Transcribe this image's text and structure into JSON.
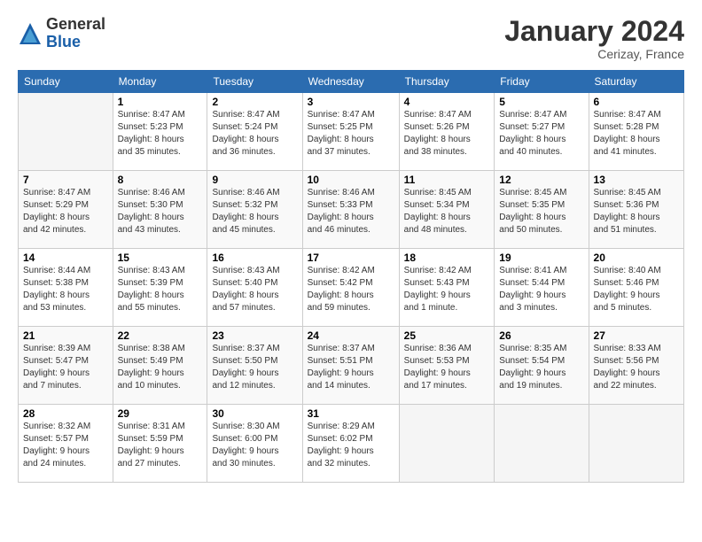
{
  "logo": {
    "general": "General",
    "blue": "Blue"
  },
  "title": "January 2024",
  "location": "Cerizay, France",
  "days_header": [
    "Sunday",
    "Monday",
    "Tuesday",
    "Wednesday",
    "Thursday",
    "Friday",
    "Saturday"
  ],
  "weeks": [
    [
      {
        "day": "",
        "info": ""
      },
      {
        "day": "1",
        "info": "Sunrise: 8:47 AM\nSunset: 5:23 PM\nDaylight: 8 hours\nand 35 minutes."
      },
      {
        "day": "2",
        "info": "Sunrise: 8:47 AM\nSunset: 5:24 PM\nDaylight: 8 hours\nand 36 minutes."
      },
      {
        "day": "3",
        "info": "Sunrise: 8:47 AM\nSunset: 5:25 PM\nDaylight: 8 hours\nand 37 minutes."
      },
      {
        "day": "4",
        "info": "Sunrise: 8:47 AM\nSunset: 5:26 PM\nDaylight: 8 hours\nand 38 minutes."
      },
      {
        "day": "5",
        "info": "Sunrise: 8:47 AM\nSunset: 5:27 PM\nDaylight: 8 hours\nand 40 minutes."
      },
      {
        "day": "6",
        "info": "Sunrise: 8:47 AM\nSunset: 5:28 PM\nDaylight: 8 hours\nand 41 minutes."
      }
    ],
    [
      {
        "day": "7",
        "info": "Sunrise: 8:47 AM\nSunset: 5:29 PM\nDaylight: 8 hours\nand 42 minutes."
      },
      {
        "day": "8",
        "info": "Sunrise: 8:46 AM\nSunset: 5:30 PM\nDaylight: 8 hours\nand 43 minutes."
      },
      {
        "day": "9",
        "info": "Sunrise: 8:46 AM\nSunset: 5:32 PM\nDaylight: 8 hours\nand 45 minutes."
      },
      {
        "day": "10",
        "info": "Sunrise: 8:46 AM\nSunset: 5:33 PM\nDaylight: 8 hours\nand 46 minutes."
      },
      {
        "day": "11",
        "info": "Sunrise: 8:45 AM\nSunset: 5:34 PM\nDaylight: 8 hours\nand 48 minutes."
      },
      {
        "day": "12",
        "info": "Sunrise: 8:45 AM\nSunset: 5:35 PM\nDaylight: 8 hours\nand 50 minutes."
      },
      {
        "day": "13",
        "info": "Sunrise: 8:45 AM\nSunset: 5:36 PM\nDaylight: 8 hours\nand 51 minutes."
      }
    ],
    [
      {
        "day": "14",
        "info": "Sunrise: 8:44 AM\nSunset: 5:38 PM\nDaylight: 8 hours\nand 53 minutes."
      },
      {
        "day": "15",
        "info": "Sunrise: 8:43 AM\nSunset: 5:39 PM\nDaylight: 8 hours\nand 55 minutes."
      },
      {
        "day": "16",
        "info": "Sunrise: 8:43 AM\nSunset: 5:40 PM\nDaylight: 8 hours\nand 57 minutes."
      },
      {
        "day": "17",
        "info": "Sunrise: 8:42 AM\nSunset: 5:42 PM\nDaylight: 8 hours\nand 59 minutes."
      },
      {
        "day": "18",
        "info": "Sunrise: 8:42 AM\nSunset: 5:43 PM\nDaylight: 9 hours\nand 1 minute."
      },
      {
        "day": "19",
        "info": "Sunrise: 8:41 AM\nSunset: 5:44 PM\nDaylight: 9 hours\nand 3 minutes."
      },
      {
        "day": "20",
        "info": "Sunrise: 8:40 AM\nSunset: 5:46 PM\nDaylight: 9 hours\nand 5 minutes."
      }
    ],
    [
      {
        "day": "21",
        "info": "Sunrise: 8:39 AM\nSunset: 5:47 PM\nDaylight: 9 hours\nand 7 minutes."
      },
      {
        "day": "22",
        "info": "Sunrise: 8:38 AM\nSunset: 5:49 PM\nDaylight: 9 hours\nand 10 minutes."
      },
      {
        "day": "23",
        "info": "Sunrise: 8:37 AM\nSunset: 5:50 PM\nDaylight: 9 hours\nand 12 minutes."
      },
      {
        "day": "24",
        "info": "Sunrise: 8:37 AM\nSunset: 5:51 PM\nDaylight: 9 hours\nand 14 minutes."
      },
      {
        "day": "25",
        "info": "Sunrise: 8:36 AM\nSunset: 5:53 PM\nDaylight: 9 hours\nand 17 minutes."
      },
      {
        "day": "26",
        "info": "Sunrise: 8:35 AM\nSunset: 5:54 PM\nDaylight: 9 hours\nand 19 minutes."
      },
      {
        "day": "27",
        "info": "Sunrise: 8:33 AM\nSunset: 5:56 PM\nDaylight: 9 hours\nand 22 minutes."
      }
    ],
    [
      {
        "day": "28",
        "info": "Sunrise: 8:32 AM\nSunset: 5:57 PM\nDaylight: 9 hours\nand 24 minutes."
      },
      {
        "day": "29",
        "info": "Sunrise: 8:31 AM\nSunset: 5:59 PM\nDaylight: 9 hours\nand 27 minutes."
      },
      {
        "day": "30",
        "info": "Sunrise: 8:30 AM\nSunset: 6:00 PM\nDaylight: 9 hours\nand 30 minutes."
      },
      {
        "day": "31",
        "info": "Sunrise: 8:29 AM\nSunset: 6:02 PM\nDaylight: 9 hours\nand 32 minutes."
      },
      {
        "day": "",
        "info": ""
      },
      {
        "day": "",
        "info": ""
      },
      {
        "day": "",
        "info": ""
      }
    ]
  ]
}
